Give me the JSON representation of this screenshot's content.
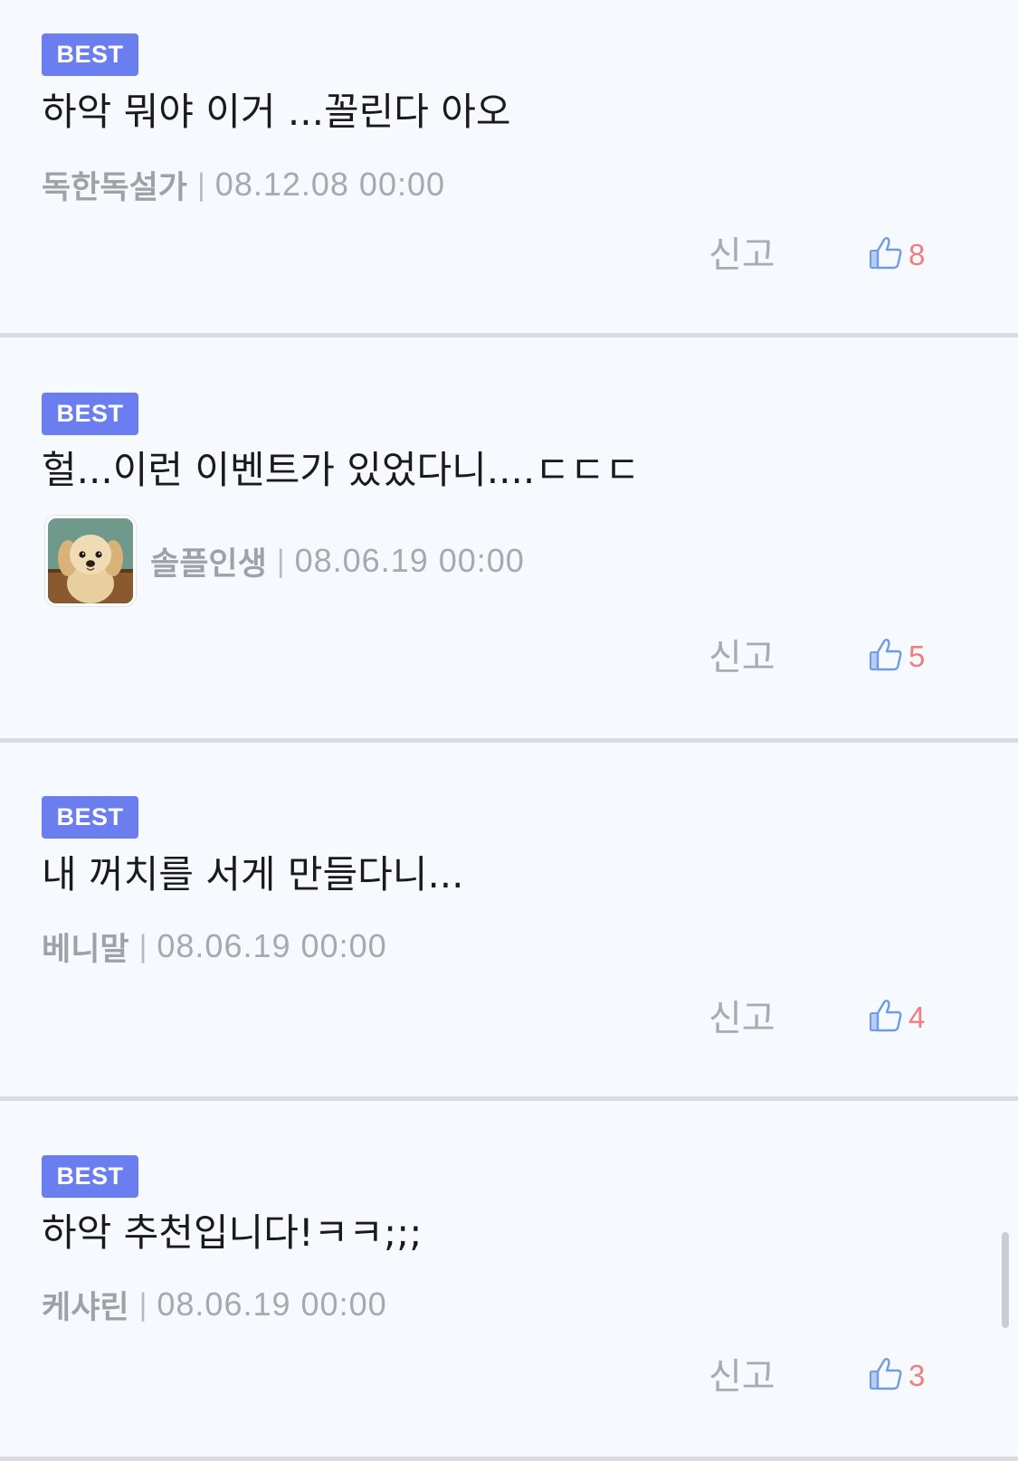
{
  "comments": [
    {
      "badge": "BEST",
      "text": "하악 뭐야 이거 ...꼴린다 아오",
      "author": "독한독설가",
      "separator": "|",
      "date": "08.12.08 00:00",
      "report_label": "신고",
      "likes": "8",
      "has_avatar": false
    },
    {
      "badge": "BEST",
      "text": "헐...이런 이벤트가 있었다니....ㄷㄷㄷ",
      "author": "솔플인생",
      "separator": "|",
      "date": "08.06.19 00:00",
      "report_label": "신고",
      "likes": "5",
      "has_avatar": true
    },
    {
      "badge": "BEST",
      "text": "내 꺼치를 서게 만들다니...",
      "author": "베니말",
      "separator": "|",
      "date": "08.06.19 00:00",
      "report_label": "신고",
      "likes": "4",
      "has_avatar": false
    },
    {
      "badge": "BEST",
      "text": "하악 추천입니다!ㅋㅋ;;;",
      "author": "케샤린",
      "separator": "|",
      "date": "08.06.19 00:00",
      "report_label": "신고",
      "likes": "3",
      "has_avatar": false
    }
  ],
  "icons": {
    "like": "thumbs-up-icon",
    "avatar": "dog-avatar-image"
  },
  "colors": {
    "background": "#f6f9fe",
    "badge": "#6b7ef0",
    "like_count": "#ef7f7f",
    "thumb_icon": "#6f9be6",
    "divider": "#d9dcdf"
  }
}
